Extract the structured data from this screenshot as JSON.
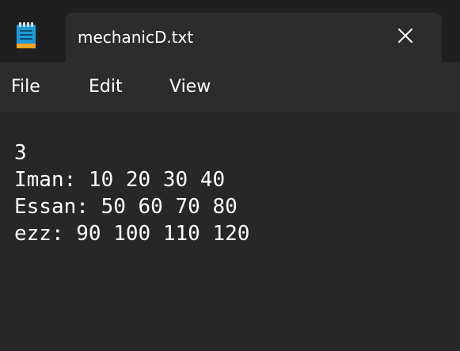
{
  "window": {
    "tab_title": "mechanicD.txt",
    "app_icon": "notepad-icon",
    "close_icon": "close-icon"
  },
  "menu": {
    "file": "File",
    "edit": "Edit",
    "view": "View"
  },
  "editor": {
    "lines": [
      "3",
      "Iman: 10 20 30 40",
      "Essan: 50 60 70 80",
      "ezz: 90 100 110 120"
    ]
  },
  "colors": {
    "titlebar_bg": "#1f1f1f",
    "tab_bg": "#2c2c2c",
    "editor_bg": "#272727",
    "text": "#ffffff",
    "notepad_blue": "#1e9bd7"
  }
}
